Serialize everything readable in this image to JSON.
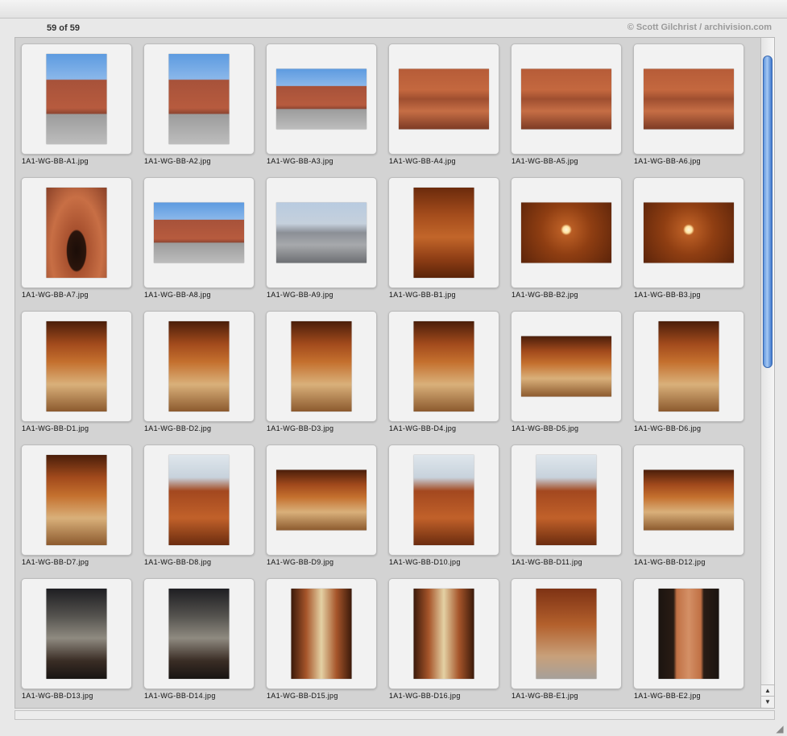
{
  "header": {
    "count_label": "59 of 59",
    "credit": "© Scott Gilchrist / archivision.com"
  },
  "thumbnails": [
    {
      "file": "1A1-WG-BB-A1.jpg"
    },
    {
      "file": "1A1-WG-BB-A2.jpg"
    },
    {
      "file": "1A1-WG-BB-A3.jpg"
    },
    {
      "file": "1A1-WG-BB-A4.jpg"
    },
    {
      "file": "1A1-WG-BB-A5.jpg"
    },
    {
      "file": "1A1-WG-BB-A6.jpg"
    },
    {
      "file": "1A1-WG-BB-A7.jpg"
    },
    {
      "file": "1A1-WG-BB-A8.jpg"
    },
    {
      "file": "1A1-WG-BB-A9.jpg"
    },
    {
      "file": "1A1-WG-BB-B1.jpg"
    },
    {
      "file": "1A1-WG-BB-B2.jpg"
    },
    {
      "file": "1A1-WG-BB-B3.jpg"
    },
    {
      "file": "1A1-WG-BB-D1.jpg"
    },
    {
      "file": "1A1-WG-BB-D2.jpg"
    },
    {
      "file": "1A1-WG-BB-D3.jpg"
    },
    {
      "file": "1A1-WG-BB-D4.jpg"
    },
    {
      "file": "1A1-WG-BB-D5.jpg"
    },
    {
      "file": "1A1-WG-BB-D6.jpg"
    },
    {
      "file": "1A1-WG-BB-D7.jpg"
    },
    {
      "file": "1A1-WG-BB-D8.jpg"
    },
    {
      "file": "1A1-WG-BB-D9.jpg"
    },
    {
      "file": "1A1-WG-BB-D10.jpg"
    },
    {
      "file": "1A1-WG-BB-D11.jpg"
    },
    {
      "file": "1A1-WG-BB-D12.jpg"
    },
    {
      "file": "1A1-WG-BB-D13.jpg"
    },
    {
      "file": "1A1-WG-BB-D14.jpg"
    },
    {
      "file": "1A1-WG-BB-D15.jpg"
    },
    {
      "file": "1A1-WG-BB-D16.jpg"
    },
    {
      "file": "1A1-WG-BB-E1.jpg"
    },
    {
      "file": "1A1-WG-BB-E2.jpg"
    }
  ],
  "scrollbar": {
    "up_arrow": "▲",
    "down_arrow": "▼"
  },
  "colors": {
    "scroll_thumb": "#5e95de",
    "panel_bg": "#d3d3d3",
    "credit_text": "#9a9a9a"
  }
}
